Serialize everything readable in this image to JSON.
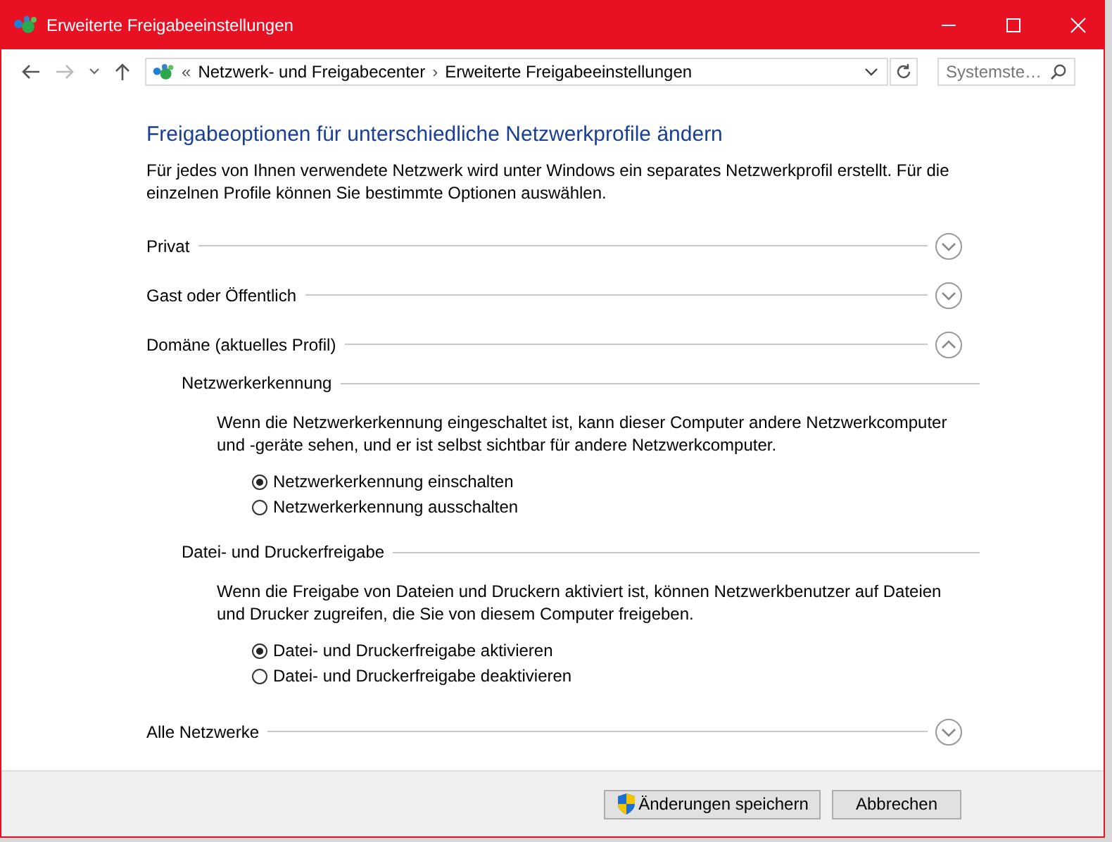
{
  "window": {
    "title": "Erweiterte Freigabeeinstellungen"
  },
  "address_bar": {
    "prefix": "«",
    "breadcrumb": [
      "Netzwerk- und Freigabecenter",
      "Erweiterte Freigabeeinstellungen"
    ],
    "separator": "›"
  },
  "search": {
    "placeholder": "Systemste…"
  },
  "heading": "Freigabeoptionen für unterschiedliche Netzwerkprofile ändern",
  "intro": "Für jedes von Ihnen verwendete Netzwerk wird unter Windows ein separates Netzwerkprofil erstellt. Für die einzelnen Profile können Sie bestimmte Optionen auswählen.",
  "profiles": [
    {
      "label": "Privat",
      "expanded": false
    },
    {
      "label": "Gast oder Öffentlich",
      "expanded": false
    },
    {
      "label": "Domäne (aktuelles Profil)",
      "expanded": true,
      "sections": [
        {
          "title": "Netzwerkerkennung",
          "description": "Wenn die Netzwerkerkennung eingeschaltet ist, kann dieser Computer andere Netzwerkcomputer und -geräte sehen, und er ist selbst sichtbar für andere Netzwerkcomputer.",
          "options": [
            {
              "label": "Netzwerkerkennung einschalten",
              "selected": true
            },
            {
              "label": "Netzwerkerkennung ausschalten",
              "selected": false
            }
          ]
        },
        {
          "title": "Datei- und Druckerfreigabe",
          "description": "Wenn die Freigabe von Dateien und Druckern aktiviert ist, können Netzwerkbenutzer auf Dateien und Drucker zugreifen, die Sie von diesem Computer freigeben.",
          "options": [
            {
              "label": "Datei- und Druckerfreigabe aktivieren",
              "selected": true
            },
            {
              "label": "Datei- und Druckerfreigabe deaktivieren",
              "selected": false
            }
          ]
        }
      ]
    },
    {
      "label": "Alle Netzwerke",
      "expanded": false
    }
  ],
  "buttons": [
    {
      "label": "Änderungen speichern",
      "kind": "shield"
    },
    {
      "label": "Abbrechen",
      "kind": "plain"
    }
  ]
}
